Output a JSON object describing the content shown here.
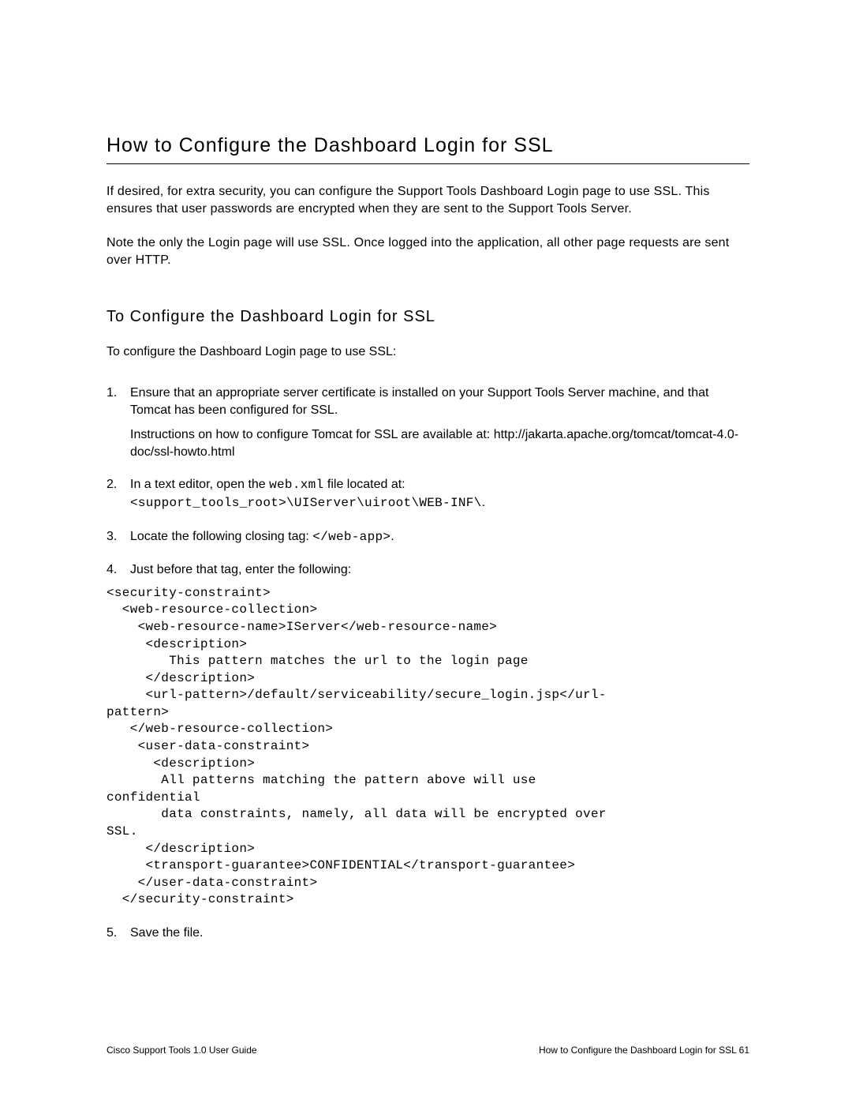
{
  "title": "How to Configure the Dashboard Login for SSL",
  "intro1": "If desired, for extra security, you can configure the Support Tools Dashboard Login page to use SSL. This ensures that user passwords are encrypted when they are sent to the Support Tools Server.",
  "intro2": "Note the only the Login page will use SSL. Once logged into the application, all other page requests are sent over HTTP.",
  "subhead": "To Configure the Dashboard Login for SSL",
  "lead": "To configure the Dashboard Login page to use SSL:",
  "steps": {
    "s1": {
      "num": "1.",
      "text": "Ensure that an appropriate server certificate is installed on your Support Tools Server machine, and that Tomcat has been configured for SSL.",
      "sub": "Instructions on how to configure Tomcat for SSL are available at: http://jakarta.apache.org/tomcat/tomcat-4.0-doc/ssl-howto.html"
    },
    "s2": {
      "num": "2.",
      "text_a": "In a text editor, open the ",
      "code_a": "web.xml",
      "text_b": " file located at: ",
      "code_b": "<support_tools_root>\\UIServer\\uiroot\\WEB-INF\\",
      "text_c": "."
    },
    "s3": {
      "num": "3.",
      "text_a": "Locate the following closing tag: ",
      "code_a": "</web-app>",
      "text_b": "."
    },
    "s4": {
      "num": "4.",
      "text": "Just before that tag, enter the following:",
      "code": "<security-constraint>\n  <web-resource-collection>\n    <web-resource-name>IServer</web-resource-name>\n     <description>\n        This pattern matches the url to the login page\n     </description>\n     <url-pattern>/default/serviceability/secure_login.jsp</url-\npattern>\n   </web-resource-collection>\n    <user-data-constraint>\n      <description>\n       All patterns matching the pattern above will use\nconfidential\n       data constraints, namely, all data will be encrypted over\nSSL.\n     </description>\n     <transport-guarantee>CONFIDENTIAL</transport-guarantee>\n    </user-data-constraint>\n  </security-constraint>"
    },
    "s5": {
      "num": "5.",
      "text": "Save the file."
    }
  },
  "footer": {
    "left": "Cisco Support Tools 1.0 User Guide",
    "right": "How to Configure the Dashboard Login for SSL   61"
  }
}
